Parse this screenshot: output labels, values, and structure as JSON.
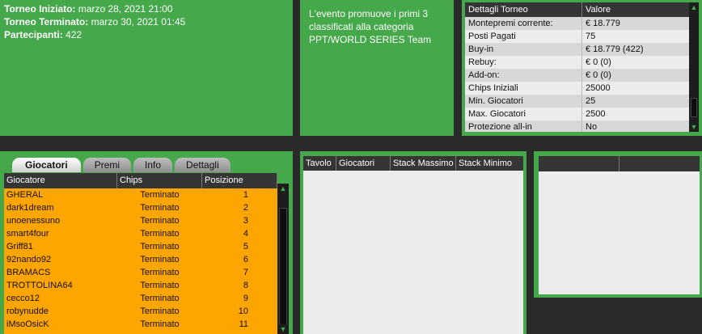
{
  "tournament": {
    "started_label": "Torneo Iniziato:",
    "started_value": "marzo 28, 2021 21:00",
    "ended_label": "Torneo Terminato:",
    "ended_value": "marzo 30, 2021 01:45",
    "participants_label": "Partecipanti:",
    "participants_value": "422"
  },
  "description": "L'evento promuove i primi 3 classificati alla categoria PPT/WORLD SERIES Team",
  "details": {
    "header_key": "Dettagli Torneo",
    "header_value": "Valore",
    "rows": [
      {
        "key": "Montepremi corrente:",
        "value": "€ 18.779"
      },
      {
        "key": "Posti Pagati",
        "value": "75"
      },
      {
        "key": "Buy-in",
        "value": "€ 18.779 (422)"
      },
      {
        "key": "Rebuy:",
        "value": "€ 0 (0)"
      },
      {
        "key": "Add-on:",
        "value": "€ 0 (0)"
      },
      {
        "key": "Chips Iniziali",
        "value": "25000"
      },
      {
        "key": "Min. Giocatori",
        "value": "25"
      },
      {
        "key": "Max. Giocatori",
        "value": "2500"
      },
      {
        "key": "Protezione all-in",
        "value": "No"
      }
    ]
  },
  "tabs": [
    {
      "label": "Giocatori",
      "active": true
    },
    {
      "label": "Premi",
      "active": false
    },
    {
      "label": "Info",
      "active": false
    },
    {
      "label": "Dettagli",
      "active": false
    }
  ],
  "players": {
    "headers": [
      "Giocatore",
      "Chips",
      "Posizione"
    ],
    "rows": [
      {
        "name": "GHERAL",
        "chips": "Terminato",
        "pos": "1"
      },
      {
        "name": "dark1dream",
        "chips": "Terminato",
        "pos": "2"
      },
      {
        "name": "unoenessuno",
        "chips": "Terminato",
        "pos": "3"
      },
      {
        "name": "smart4four",
        "chips": "Terminato",
        "pos": "4"
      },
      {
        "name": "Griff81",
        "chips": "Terminato",
        "pos": "5"
      },
      {
        "name": "92nando92",
        "chips": "Terminato",
        "pos": "6"
      },
      {
        "name": "BRAMACS",
        "chips": "Terminato",
        "pos": "7"
      },
      {
        "name": "TROTTOLINA64",
        "chips": "Terminato",
        "pos": "8"
      },
      {
        "name": "cecco12",
        "chips": "Terminato",
        "pos": "9"
      },
      {
        "name": "robynudde",
        "chips": "Terminato",
        "pos": "10"
      },
      {
        "name": "iMsoOsicK",
        "chips": "Terminato",
        "pos": "11"
      }
    ]
  },
  "tables": {
    "headers": [
      "Tavolo",
      "Giocatori",
      "Stack Massimo",
      "Stack Minimo"
    ]
  },
  "icons": {
    "scroll_up": "arrow-up-icon",
    "scroll_down": "arrow-down-icon"
  },
  "colors": {
    "panel_green": "#45a84a",
    "row_orange": "#ffa500",
    "header_dark": "#353535"
  }
}
